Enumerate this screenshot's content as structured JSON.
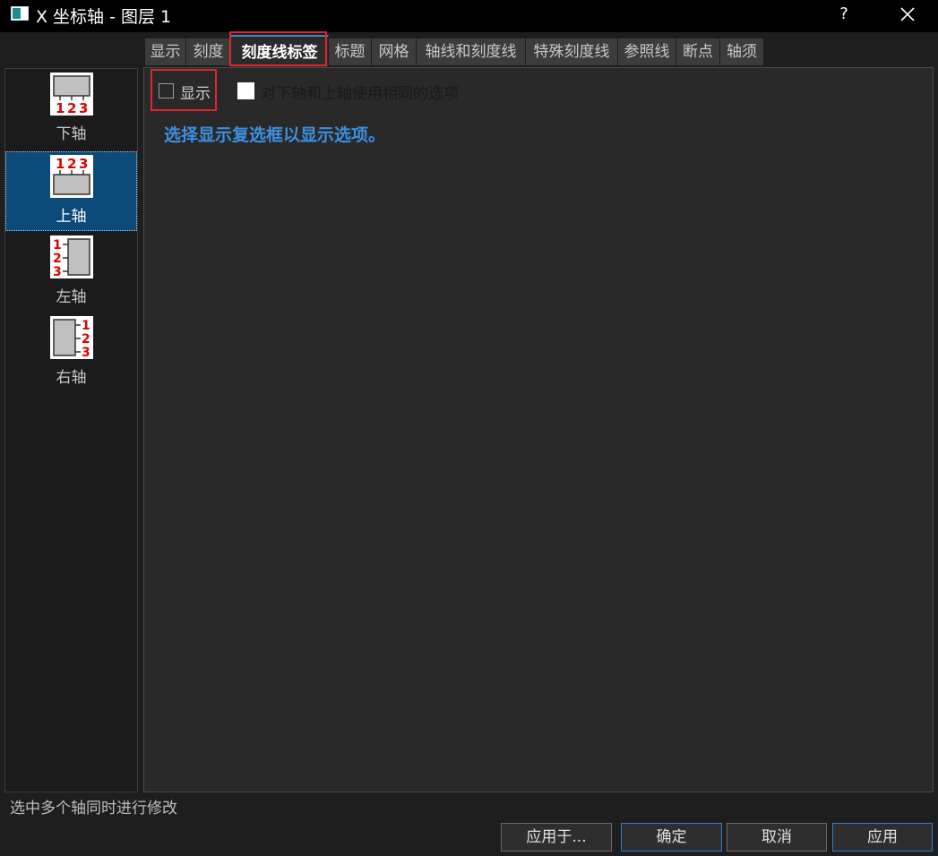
{
  "window": {
    "title": "X 坐标轴 - 图层 1",
    "help": "?"
  },
  "sidebar": {
    "items": [
      {
        "label": "下轴",
        "digits": [
          "1",
          "2",
          "3"
        ],
        "selected": false
      },
      {
        "label": "上轴",
        "digits": [
          "1",
          "2",
          "3"
        ],
        "selected": true
      },
      {
        "label": "左轴",
        "digits": [
          "1",
          "2",
          "3"
        ],
        "selected": false
      },
      {
        "label": "右轴",
        "digits": [
          "1",
          "2",
          "3"
        ],
        "selected": false
      }
    ]
  },
  "tabs": [
    {
      "label": "显示"
    },
    {
      "label": "刻度"
    },
    {
      "label": "刻度线标签",
      "active": true
    },
    {
      "label": "标题"
    },
    {
      "label": "网格"
    },
    {
      "label": "轴线和刻度线"
    },
    {
      "label": "特殊刻度线"
    },
    {
      "label": "参照线"
    },
    {
      "label": "断点"
    },
    {
      "label": "轴须"
    }
  ],
  "panel": {
    "show_label": "显示",
    "show_checked": false,
    "same_label": "对下轴和上轴使用相同的选项",
    "same_checked": false,
    "hint": "选择显示复选框以显示选项。"
  },
  "status": "选中多个轴同时进行修改",
  "buttons": {
    "apply_to": "应用于...",
    "ok": "确定",
    "cancel": "取消",
    "apply": "应用"
  },
  "colors": {
    "highlight": "#e0262b",
    "accent": "#3d8fe0",
    "selected_bg": "#0b4a79",
    "icon_digits": "#e00000"
  }
}
